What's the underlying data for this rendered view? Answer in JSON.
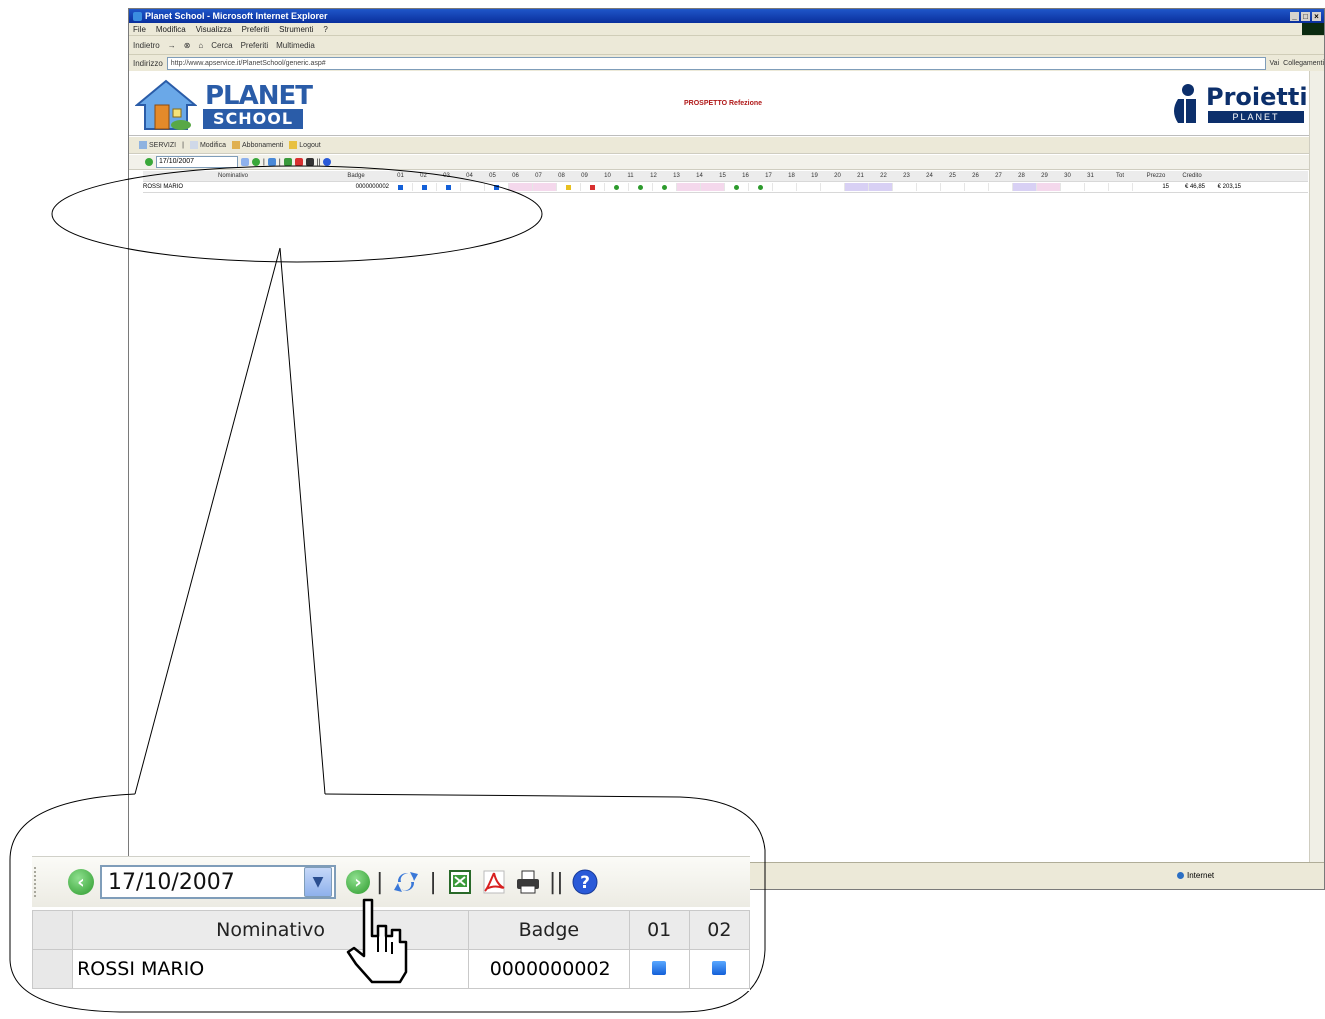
{
  "window": {
    "title": "Planet School - Microsoft Internet Explorer",
    "menu": [
      "File",
      "Modifica",
      "Visualizza",
      "Preferiti",
      "Strumenti",
      "?"
    ],
    "toolbar": [
      "Indietro",
      "Cerca",
      "Preferiti",
      "Multimedia"
    ],
    "address_label": "Indirizzo",
    "url": "http://www.apservice.it/PlanetSchool/generic.asp#",
    "go_label": "Vai",
    "links_label": "Collegamenti",
    "status_zone": "Internet"
  },
  "app": {
    "logo_top": "PLANET",
    "logo_bottom": "SCHOOL",
    "page_title": "PROSPETTO Refezione",
    "brand_name": "Proietti",
    "brand_sub": "PLANET",
    "menu": [
      "SERVIZI",
      "Modifica",
      "Abbonamenti",
      "Logout"
    ]
  },
  "toolbar": {
    "date": "17/10/2007",
    "icons": [
      "back-icon",
      "calendar-dropdown-icon",
      "go-icon",
      "refresh-icon",
      "excel-icon",
      "pdf-icon",
      "print-icon",
      "help-icon"
    ]
  },
  "grid": {
    "headers": [
      "Nominativo",
      "Badge",
      "01",
      "02",
      "03",
      "04",
      "05",
      "06",
      "07",
      "08",
      "09",
      "10",
      "11",
      "12",
      "13",
      "14",
      "15",
      "16",
      "17",
      "18",
      "19",
      "20",
      "21",
      "22",
      "23",
      "24",
      "25",
      "26",
      "27",
      "28",
      "29",
      "30",
      "31",
      "Tot",
      "Prezzo",
      "Credito"
    ],
    "row": {
      "name": "ROSSI MARIO",
      "badge": "0000000002",
      "total": "15",
      "price": "€ 46,85",
      "credit": "€ 203,15"
    },
    "day_status": [
      "blue",
      "blue",
      "blue",
      "empty",
      "blue",
      "pink",
      "pink",
      "yellow",
      "red",
      "green2",
      "green",
      "green",
      "pink",
      "pink",
      "green",
      "green",
      "empty",
      "empty",
      "empty",
      "lilac",
      "lilac",
      "empty",
      "empty",
      "empty",
      "empty",
      "empty",
      "lilac",
      "pink",
      "empty",
      "empty",
      "empty"
    ]
  },
  "zoom": {
    "date": "17/10/2007",
    "col_name": "Nominativo",
    "col_badge": "Badge",
    "col_d1": "01",
    "col_d2": "02",
    "name": "ROSSI MARIO",
    "badge": "0000000002"
  },
  "colors": {
    "ie_title": "#0a2f9c",
    "planet_blue": "#2a5ca8",
    "title_red": "#b01818",
    "cell_blue": "#1460d8"
  }
}
